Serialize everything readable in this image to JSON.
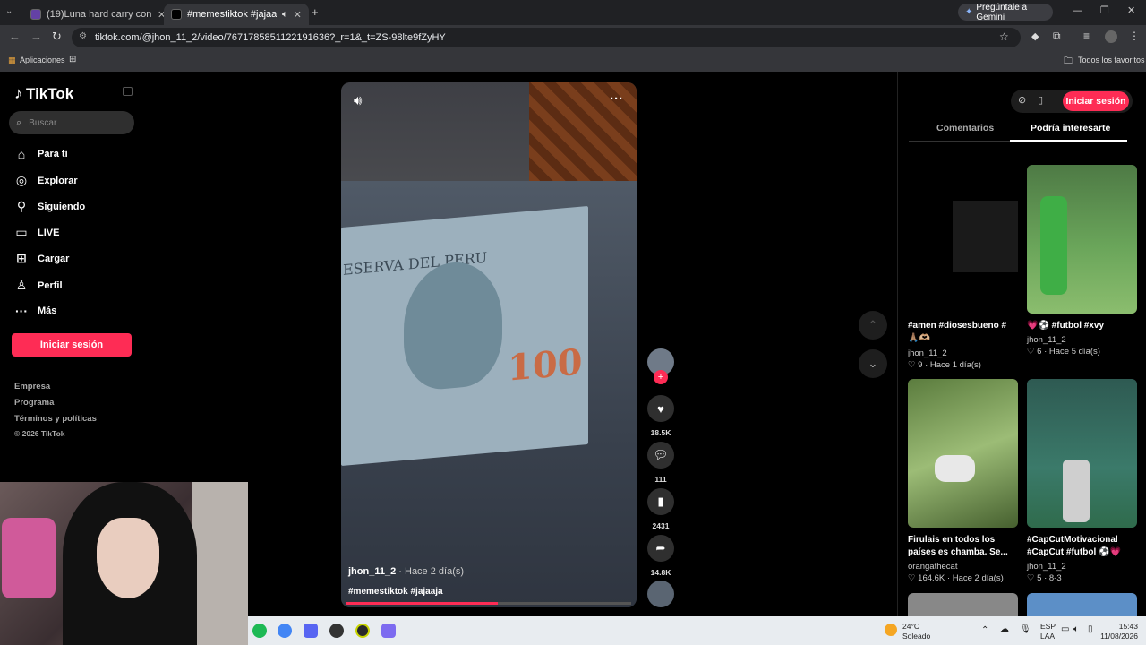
{
  "browser": {
    "tabs": [
      {
        "title": "(19)Luna hard carry con daga c"
      },
      {
        "title": "#memestiktok #jajaaja | Tik"
      }
    ],
    "url": "tiktok.com/@jhon_11_2/video/7671785851122191636?_r=1&_t=ZS-98lte9fZyHY",
    "gemini_label": "Pregúntale a Gemini",
    "bookmarks_apps": "Aplicaciones",
    "bookmarks_all": "Todos los favoritos"
  },
  "sidebar": {
    "logo": "TikTok",
    "search_placeholder": "Buscar",
    "nav": [
      {
        "label": "Para ti",
        "icon": "home-icon"
      },
      {
        "label": "Explorar",
        "icon": "compass-icon"
      },
      {
        "label": "Siguiendo",
        "icon": "following-icon"
      },
      {
        "label": "LIVE",
        "icon": "live-icon"
      },
      {
        "label": "Cargar",
        "icon": "upload-icon"
      },
      {
        "label": "Perfil",
        "icon": "profile-icon"
      },
      {
        "label": "Más",
        "icon": "more-icon"
      }
    ],
    "login": "Iniciar sesión",
    "footer": [
      "Empresa",
      "Programa",
      "Términos y políticas",
      "© 2026 TikTok"
    ]
  },
  "video": {
    "author": "jhon_11_2",
    "time": "Hace 2 día(s)",
    "caption": "#memestiktok #jajaaja",
    "bill_header": "ESERVA DEL PERU",
    "bill_value": "100",
    "progress": 0.53,
    "likes": "18.5K",
    "comments": "111",
    "saves": "2431",
    "shares": "14.8K"
  },
  "right_panel": {
    "login": "Iniciar sesión",
    "tabs": [
      "Comentarios",
      "Podría interesarte"
    ],
    "cards": [
      {
        "title": "#amen #diosesbueno # 🙏🏽🫶🏼",
        "author": "jhon_11_2",
        "likes": "9",
        "time": "Hace 1 día(s)"
      },
      {
        "title": "💗⚽ #futbol #xvy",
        "author": "jhon_11_2",
        "likes": "6",
        "time": "Hace 5 día(s)"
      },
      {
        "title": "Firulais en todos los países es chamba. Se...",
        "author": "orangathecat",
        "likes": "164.6K",
        "time": "Hace 2 día(s)"
      },
      {
        "title": "#CapCutMotivacional #CapCut #futbol ⚽💗",
        "author": "jhon_11_2",
        "likes": "5",
        "time": "8-3"
      }
    ]
  },
  "taskbar": {
    "weather_temp": "24°C",
    "weather_desc": "Soleado",
    "lang1": "ESP",
    "lang2": "LAA",
    "time": "15:43",
    "date": "11/08/2026"
  }
}
